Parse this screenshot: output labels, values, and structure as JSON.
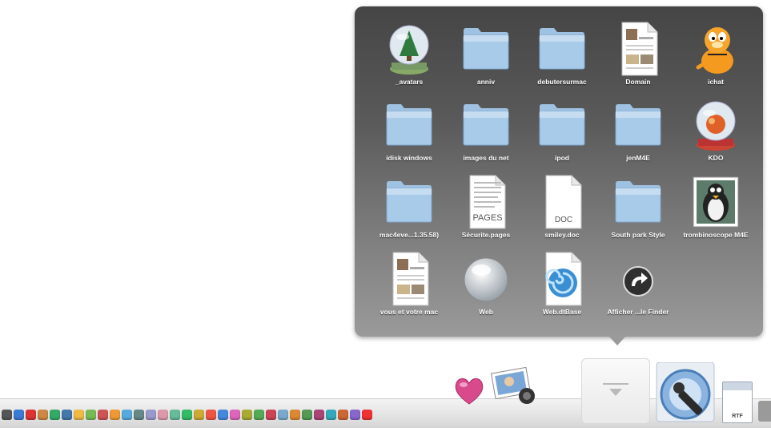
{
  "stack": {
    "items": [
      {
        "label": "_avatars",
        "icon": "snow-globe-icon"
      },
      {
        "label": "anniv",
        "icon": "folder-icon"
      },
      {
        "label": "debutersurmac",
        "icon": "folder-icon"
      },
      {
        "label": "Domain",
        "icon": "document-preview-icon"
      },
      {
        "label": "ichat",
        "icon": "garfield-icon"
      },
      {
        "label": "idisk windows",
        "icon": "folder-icon"
      },
      {
        "label": "images du net",
        "icon": "folder-icon"
      },
      {
        "label": "ipod",
        "icon": "folder-icon"
      },
      {
        "label": "jenM4E",
        "icon": "folder-icon"
      },
      {
        "label": "KDO",
        "icon": "snow-globe-red-icon"
      },
      {
        "label": "mac4eve...1.35.58)",
        "icon": "folder-icon"
      },
      {
        "label": "Sécurite.pages",
        "icon": "pages-document-icon",
        "badge": "PAGES"
      },
      {
        "label": "smiley.doc",
        "icon": "doc-document-icon",
        "badge": "DOC"
      },
      {
        "label": "South park Style",
        "icon": "folder-icon"
      },
      {
        "label": "trombinoscope M4E",
        "icon": "penguin-picture-icon"
      },
      {
        "label": "vous et votre mac",
        "icon": "document-preview-icon"
      },
      {
        "label": "Web",
        "icon": "web-sphere-icon"
      },
      {
        "label": "Web.dtBase",
        "icon": "spiral-shell-icon"
      },
      {
        "label": "Afficher ...le Finder",
        "icon": "arrow-circle-icon"
      }
    ]
  },
  "dock": {
    "small_icon_colors": [
      "#555",
      "#3a7bd5",
      "#d33",
      "#c84",
      "#3a6",
      "#47a",
      "#eb4",
      "#7b5",
      "#c55",
      "#e93",
      "#5ad",
      "#688",
      "#99c",
      "#d9a",
      "#6b9",
      "#3b6",
      "#ca3",
      "#e54",
      "#48d",
      "#d6b",
      "#aa3",
      "#5a5",
      "#c45",
      "#7ac",
      "#d83",
      "#595",
      "#a47",
      "#3ab",
      "#c63",
      "#86c",
      "#e33"
    ],
    "rtf_label": "RTF"
  }
}
